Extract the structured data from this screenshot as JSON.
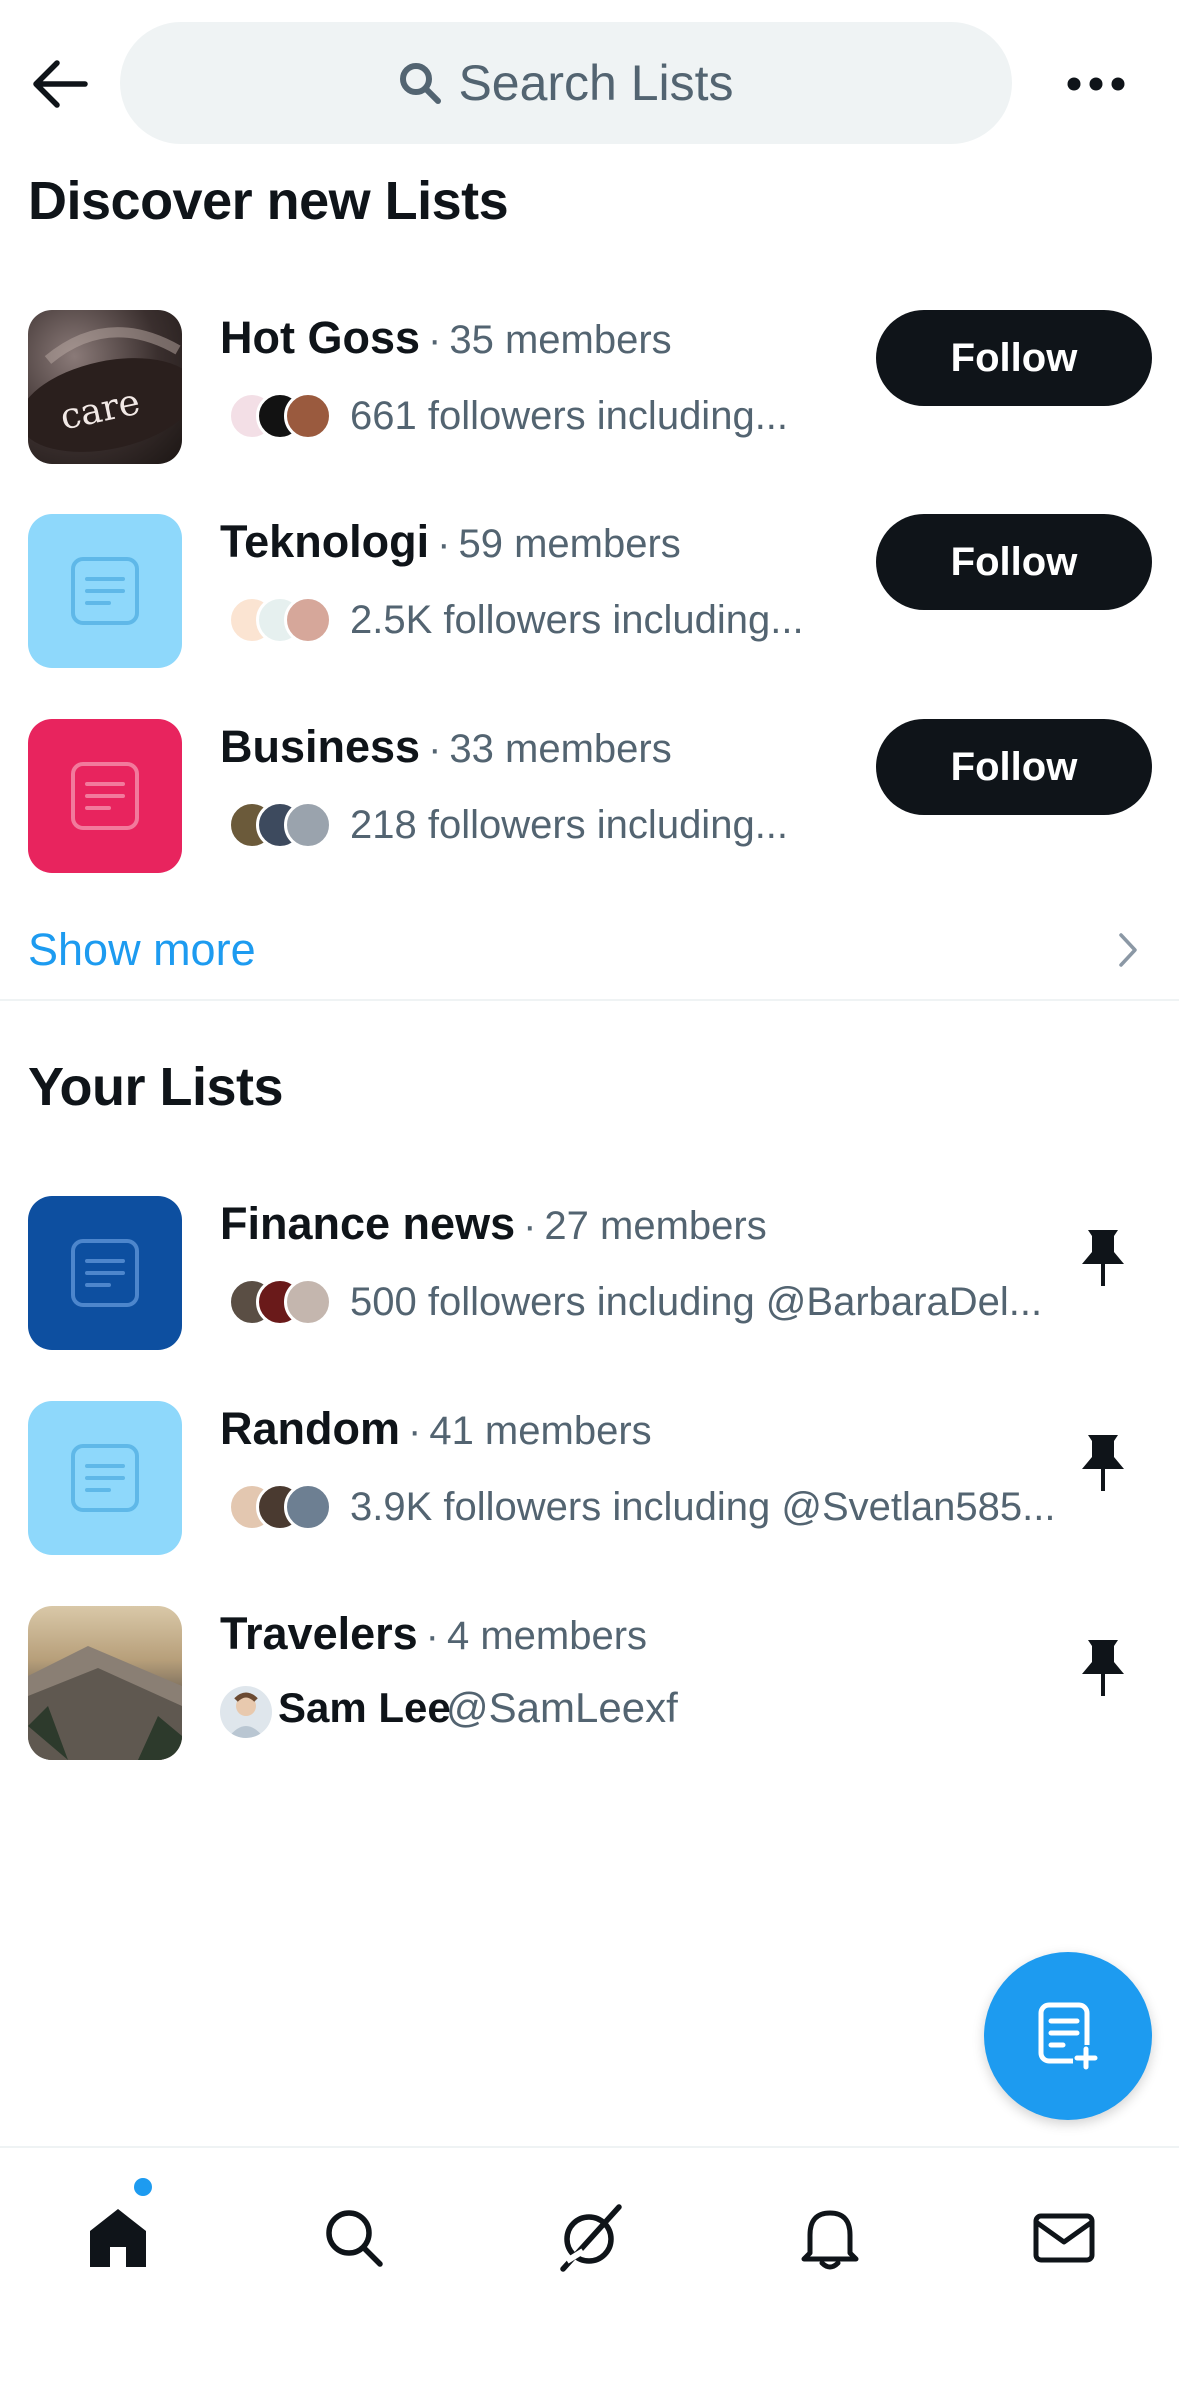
{
  "header": {
    "search_placeholder": "Search Lists",
    "back_icon": "arrow-left-icon",
    "more_icon": "more-horizontal-icon"
  },
  "discover": {
    "title": "Discover new Lists",
    "items": [
      {
        "name": "Hot Goss",
        "separator": "·",
        "members": "35 members",
        "followers": "661 followers including...",
        "button": "Follow",
        "thumb_text": "care"
      },
      {
        "name": "Teknologi",
        "separator": "·",
        "members": "59 members",
        "followers": "2.5K followers including...",
        "button": "Follow"
      },
      {
        "name": "Business",
        "separator": "·",
        "members": "33 members",
        "followers": "218 followers including...",
        "button": "Follow"
      }
    ],
    "show_more": "Show more"
  },
  "your_lists": {
    "title": "Your Lists",
    "items": [
      {
        "name": "Finance news",
        "separator": "·",
        "members": "27 members",
        "followers": "500 followers including @BarbaraDel..."
      },
      {
        "name": "Random",
        "separator": "·",
        "members": "41 members",
        "followers": "3.9K followers including @Svetlan585..."
      },
      {
        "name": "Travelers",
        "separator": "·",
        "members": "4 members",
        "owner_name": "Sam Lee",
        "owner_handle": "@SamLeexf"
      }
    ]
  },
  "colors": {
    "accent": "#1d9bf0",
    "follow_button": "#0f1419",
    "thumb_light_blue": "#8ed8fb",
    "thumb_pink": "#e8245e",
    "thumb_dark_blue": "#0d4fa0"
  },
  "nav": {
    "items": [
      "home-icon",
      "search-icon",
      "grok-icon",
      "bell-icon",
      "mail-icon"
    ]
  }
}
